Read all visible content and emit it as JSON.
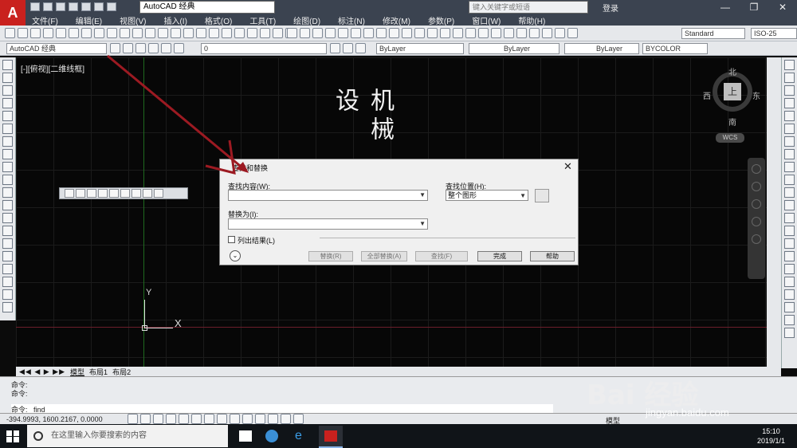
{
  "window": {
    "workspace": "AutoCAD 经典",
    "search_placeholder": "键入关键字或短语",
    "login": "登录"
  },
  "menu": [
    "文件(F)",
    "编辑(E)",
    "视图(V)",
    "插入(I)",
    "格式(O)",
    "工具(T)",
    "绘图(D)",
    "标注(N)",
    "修改(M)",
    "参数(P)",
    "窗口(W)",
    "帮助(H)"
  ],
  "toolbar": {
    "workspace_combo": "AutoCAD 经典",
    "layer_combo": "0",
    "color_combo": "ByLayer",
    "linetype_combo": "ByLayer",
    "lineweight_combo": "ByLayer",
    "plotstyle_combo": "BYCOLOR",
    "text_style": "Standard",
    "dim_style": "ISO-25"
  },
  "viewport": {
    "label": "[-][俯视][二维线框]",
    "big_text": "机械设"
  },
  "viewcube": {
    "north": "北",
    "south": "南",
    "east": "东",
    "west": "西",
    "top": "上",
    "wcs": "WCS"
  },
  "ucs": {
    "y": "Y",
    "x": "X"
  },
  "dialog": {
    "title": "查找和替换",
    "find_label": "查找内容(W):",
    "find_value": "",
    "where_label": "查找位置(H):",
    "where_value": "整个图形",
    "replace_label": "替换为(I):",
    "replace_value": "",
    "list_results": "列出结果(L)",
    "btn_replace": "替换(R)",
    "btn_replace_all": "全部替换(A)",
    "btn_find": "查找(F)",
    "btn_done": "完成",
    "btn_help": "帮助"
  },
  "layout_tabs": [
    "模型",
    "布局1",
    "布局2"
  ],
  "command": {
    "line1": "命令:",
    "line2": "命令:",
    "prompt": "命令:  _find"
  },
  "status": {
    "coords": "-394.9993, 1600.2167, 0.0000",
    "model": "模型"
  },
  "taskbar": {
    "search": "在这里输入你要搜索的内容",
    "time": "15:10",
    "date": "2019/1/1"
  },
  "watermark": {
    "brand": "Bai 经验",
    "url": "jingyan.baidu.com"
  }
}
